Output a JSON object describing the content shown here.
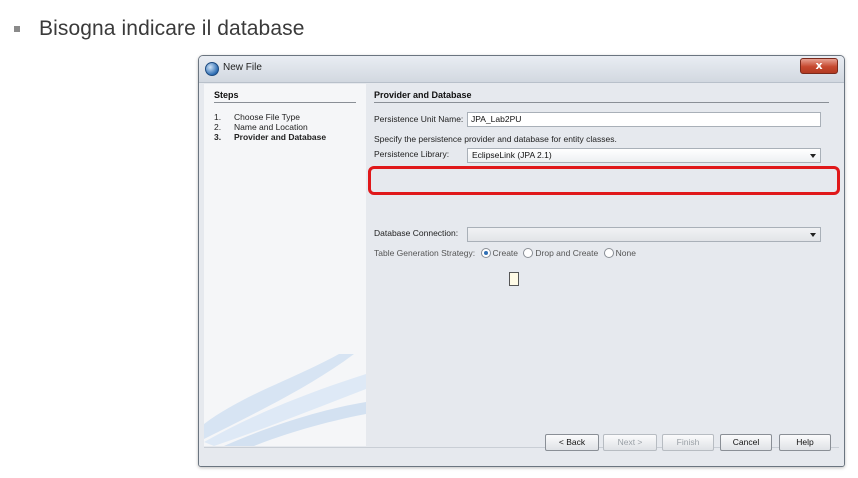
{
  "slide": {
    "bullet_text": "Bisogna indicare il database"
  },
  "dialog": {
    "title": "New File",
    "close_glyph": "x",
    "steps": {
      "header": "Steps",
      "items": [
        {
          "num": "1.",
          "label": "Choose File Type"
        },
        {
          "num": "2.",
          "label": "Name and Location"
        },
        {
          "num": "3.",
          "label": "Provider and Database"
        }
      ]
    },
    "content": {
      "header": "Provider and Database",
      "persistence_unit_label": "Persistence Unit Name:",
      "persistence_unit_value": "JPA_Lab2PU",
      "description": "Specify the persistence provider and database for entity classes.",
      "library_label": "Persistence Library:",
      "library_value": "EclipseLink (JPA 2.1)",
      "db_connection_label": "Database Connection:",
      "db_connection_value": "",
      "table_strategy_label": "Table Generation Strategy:",
      "table_strategy_options": [
        "Create",
        "Drop and Create",
        "None"
      ],
      "table_strategy_selected": "Create"
    },
    "buttons": {
      "back": "< Back",
      "next": "Next >",
      "finish": "Finish",
      "cancel": "Cancel",
      "help": "Help"
    },
    "colors": {
      "highlight": "#e0181a",
      "close": "#c6482f"
    }
  }
}
